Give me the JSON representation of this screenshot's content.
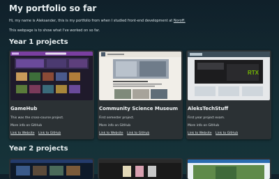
{
  "header": {
    "title": "My portfolio so far",
    "intro_before": "Hi, my name is Aleksander, this is my portfolio from when I studied front-end development at ",
    "intro_link": "Noroff.",
    "intro2": "This webpage is to show what I've worked on so far."
  },
  "sections": {
    "year1": "Year 1 projects",
    "year2": "Year 2 projects"
  },
  "projects": [
    {
      "title": "GameHub",
      "description": "This was the cross-course project.",
      "more": "More info on GitHub",
      "link_website": "Link to Website",
      "link_github": "Link to GitHub"
    },
    {
      "title": "Community Science Museum",
      "description": "First semester project.",
      "more": "More info on GitHub",
      "link_website": "Link to Website",
      "link_github": "Link to GitHub"
    },
    {
      "title": "AleksTechStuff",
      "description": "First year project exam.",
      "more": "More info on GitHub",
      "link_website": "Link to Website",
      "link_github": "Link to GitHub"
    }
  ],
  "thumbs": {
    "gamehub": "GameHub",
    "museum": "Community Science Museum",
    "tech": "AleksTechStuff",
    "tech_product": "RTX"
  },
  "colors": {
    "background": "#132a32",
    "card": "#2b3134",
    "gamehub_accent": "#7a3fa0",
    "museum_accent": "#e8e4dc",
    "tech_accent": "#3c4d59"
  }
}
